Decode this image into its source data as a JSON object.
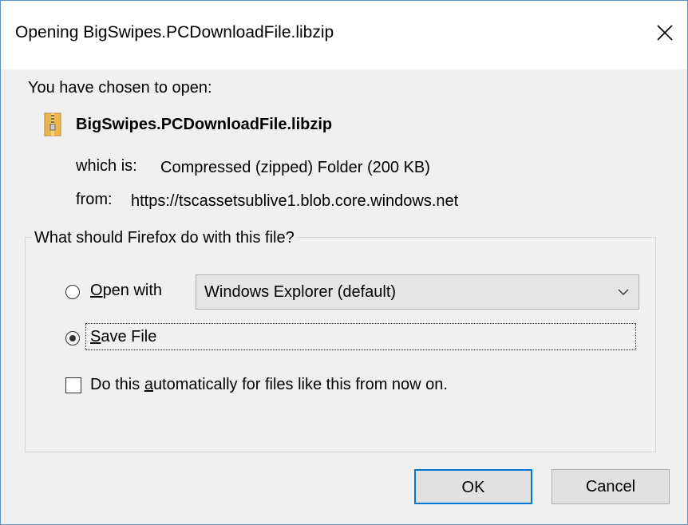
{
  "dialog": {
    "title": "Opening BigSwipes.PCDownloadFile.libzip",
    "close_icon": "close-icon"
  },
  "info": {
    "intro": "You have chosen to open:",
    "file_icon": "zip-folder-icon",
    "filename": "BigSwipes.PCDownloadFile.libzip",
    "which_is_label": "which is:",
    "which_is_value": "Compressed (zipped) Folder (200 KB)",
    "from_label": "from:",
    "from_value": "https://tscassetsublive1.blob.core.windows.net"
  },
  "action": {
    "question": "What should Firefox do with this file?",
    "open_with": {
      "label_accesskey": "O",
      "label_rest": "pen with",
      "selected": false,
      "app_selected": "Windows Explorer (default)"
    },
    "save_file": {
      "label_accesskey": "S",
      "label_rest": "ave File",
      "selected": true
    },
    "auto": {
      "label_before": "Do this ",
      "label_accesskey": "a",
      "label_after": "utomatically for files like this from now on.",
      "checked": false
    }
  },
  "buttons": {
    "ok": "OK",
    "cancel": "Cancel"
  }
}
